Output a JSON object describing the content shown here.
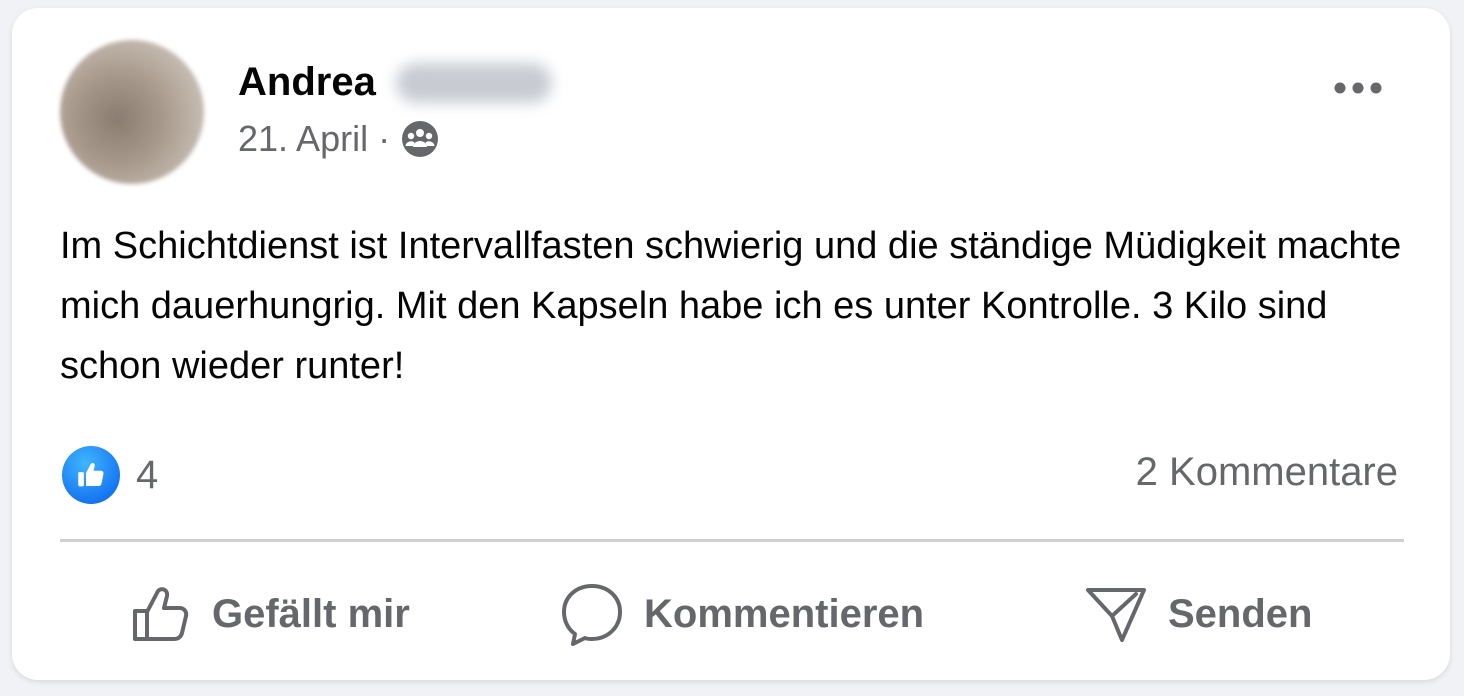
{
  "post": {
    "author_name": "Andrea",
    "date": "21. April",
    "separator": "·",
    "audience_icon": "friends-icon",
    "text": "Im Schichtdienst ist Intervallfasten schwierig und die ständige Müdigkeit machte mich dauerhungrig. Mit den Kapseln habe ich es unter Kontrolle. 3 Kilo sind schon wieder runter!",
    "reaction_icon": "like-reaction-icon",
    "reaction_count": "4",
    "comments_label": "2 Kommentare"
  },
  "actions": {
    "like_label": "Gefällt mir",
    "comment_label": "Kommentieren",
    "send_label": "Senden"
  },
  "colors": {
    "text_primary": "#050505",
    "text_secondary": "#65676b",
    "accent_blue": "#1877f2",
    "divider": "#ced0d4"
  }
}
